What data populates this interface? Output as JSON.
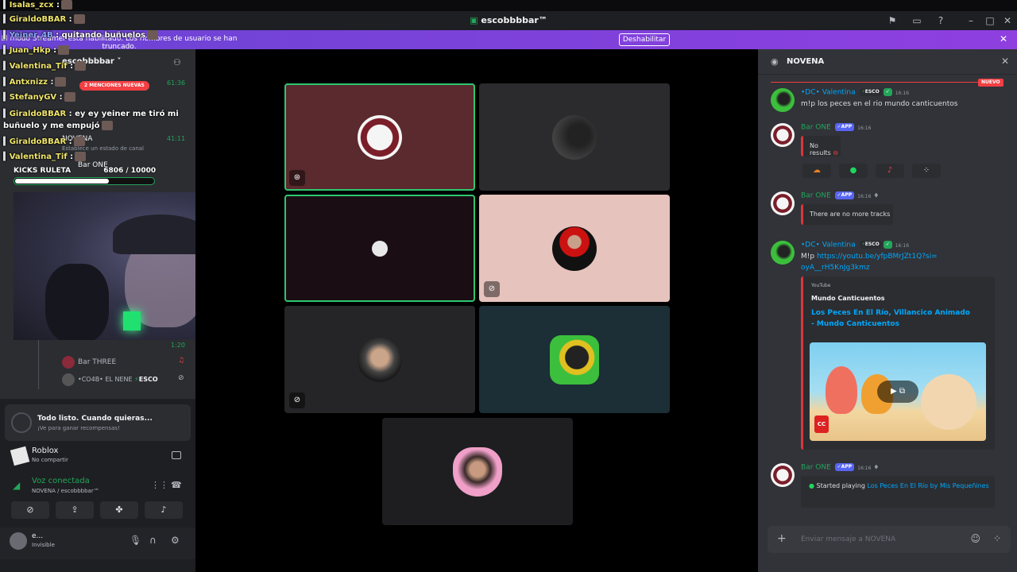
{
  "titlebar": {
    "title": "escobbbbar™"
  },
  "streamer": {
    "message": "El modo Streamer está habilitado. Los nombres de usuario se han truncado.",
    "button": "Deshabilitar"
  },
  "overlay_chat": [
    {
      "name": "Isalas_zcx",
      "text": ":"
    },
    {
      "name": "GiraldoBBAR",
      "text": ":"
    },
    {
      "name": "Yeiner_4B",
      "text": ": quitando buñuelos"
    },
    {
      "name": "Juan_Hkp",
      "text": ":"
    },
    {
      "name": "Valentina_Tif",
      "text": ":"
    },
    {
      "name": "Antxnizz",
      "text": ":"
    },
    {
      "name": "StefanyGV",
      "text": ":"
    },
    {
      "name": "GiraldoBBAR",
      "text": ": ey ey yeiner me tiró mi buñuelo y me empujó"
    },
    {
      "name": "GiraldoBBAR",
      "text": ":"
    },
    {
      "name": "Valentina_Tif",
      "text": ":"
    }
  ],
  "sidebar": {
    "server_name": "escobbbbar",
    "mentions_badge": "2 MENCIONES NUEVAS",
    "time1": "61:36",
    "time2": "41:11",
    "time3": "1:20",
    "channel_name": "NOVENA",
    "channel_status": "Establece un estado de canal",
    "ruleta": "KICKS RULETA",
    "ruleta_count": "6806  / 10000",
    "ruleta_progress": 0.68,
    "members": [
      {
        "name": "Bar ONE"
      },
      {
        "name": "Bar THREE"
      },
      {
        "name": "•CO4B• EL NENE",
        "tag": "ESCO"
      }
    ],
    "activity_title": "Todo listo. Cuando quieras...",
    "activity_sub": "¡Ve para ganar recompensas!",
    "game_name": "Roblox",
    "game_sub": "No compartir",
    "voice_title": "Voz conectada",
    "voice_sub": "NOVENA / escobbbbar™",
    "user_name": "e...",
    "user_status": "Invisible"
  },
  "chat": {
    "channel": "NOVENA",
    "new_badge": "NUEVO",
    "input_placeholder": "Enviar mensaje a NOVENA",
    "messages": [
      {
        "author": "•DC• Valentina",
        "tag": "ESCO",
        "time": "16:16",
        "text": "m!p los peces en el rio mundo canticuentos"
      },
      {
        "author": "Bar ONE",
        "tag": "APP",
        "time": "16:16",
        "embed": "No results"
      },
      {
        "author": "Bar ONE",
        "tag": "APP",
        "time": "16:16",
        "embed": "There are no more tracks"
      },
      {
        "author": "•DC• Valentina",
        "tag": "ESCO",
        "time": "16:16",
        "text": "M!p",
        "link": "https://youtu.be/yfpBMrJZt1Q?si=oyA__rH5KnJg3kmz",
        "yt_source": "YouTube",
        "yt_channel": "Mundo Canticuentos",
        "yt_title": "Los Peces En El Río, Villancico Animado - Mundo Canticuentos"
      },
      {
        "author": "Bar ONE",
        "tag": "APP",
        "time": "16:16",
        "prefix": "Started playing ",
        "track": "Los Peces En El Río by Mis Pequeñines"
      }
    ]
  },
  "colors": {
    "accent": "#5865f2",
    "speaking": "#2dc770",
    "danger": "#f23f43",
    "link": "#00a8fc"
  }
}
